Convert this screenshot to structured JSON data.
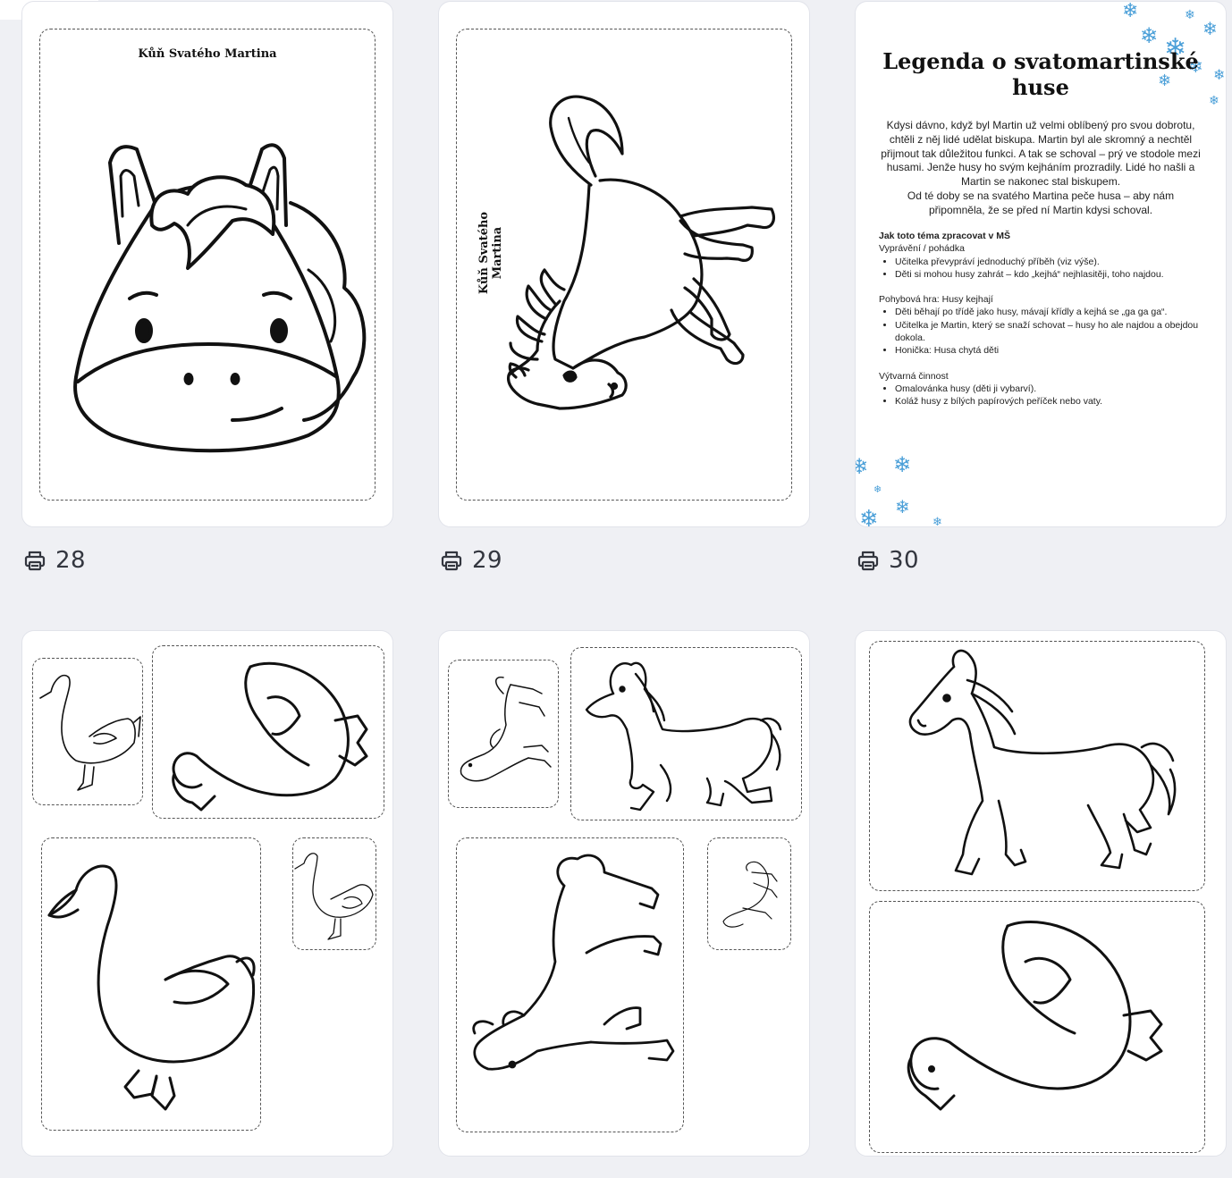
{
  "colors": {
    "background": "#eff0f4",
    "card": "#ffffff",
    "snowflake": "#4a9fd8",
    "page_number": "#33363f"
  },
  "pages": [
    {
      "number": "28",
      "title": "Kůň Svatého Martina"
    },
    {
      "number": "29",
      "title": "Kůň Svatého Martina"
    },
    {
      "number": "30",
      "title": "Legenda o svatomartinské huse"
    }
  ],
  "legend": {
    "paragraph1": "Kdysi dávno, když byl Martin už velmi oblíbený pro svou dobrotu, chtěli z něj lidé udělat biskupa. Martin byl ale skromný a nechtěl přijmout tak důležitou funkci. A tak se schoval – prý ve stodole mezi husami. Jenže husy ho svým kejháním prozradily. Lidé ho našli a Martin se nakonec stal biskupem.",
    "paragraph2": "Od té doby se na svatého Martina peče husa – aby nám připomněla, že se před ní Martin kdysi schoval.",
    "section_heading": "Jak toto téma zpracovat v MŠ",
    "block1_title": "Vyprávění / pohádka",
    "block1_items": [
      "Učitelka převypráví jednoduchý příběh (viz výše).",
      "Děti si mohou husy zahrát – kdo „kejhá“ nejhlasitěji, toho najdou."
    ],
    "block2_title": "Pohybová hra: Husy kejhají",
    "block2_items": [
      "Děti běhají po třídě jako husy, mávají křídly a kejhá se „ga ga ga“.",
      "Učitelka je Martin, který se snaží schovat – husy ho ale najdou a obejdou dokola.",
      "Honička: Husa chytá děti"
    ],
    "block3_title": "Výtvarná činnost",
    "block3_items": [
      "Omalovánka husy (děti ji vybarví).",
      "Koláž husy z bílých papírových peříček nebo vaty."
    ]
  },
  "icons": {
    "print": "printer-icon",
    "snowflake": "snowflake-icon"
  }
}
